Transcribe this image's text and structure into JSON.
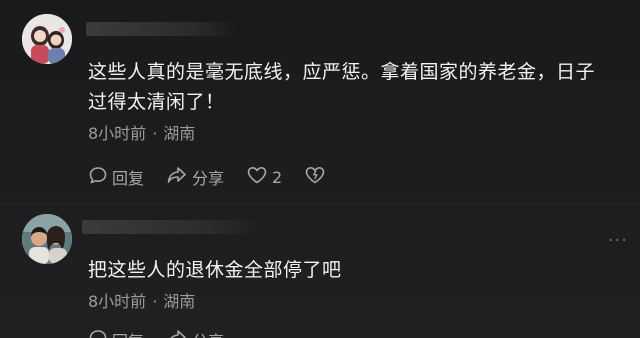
{
  "comments": [
    {
      "text_line1": "这些人真的是毫无底线，应严惩。拿着国家的养老金，日子",
      "text_line2": "过得太清闲了！",
      "time": "8小时前",
      "separator": "·",
      "location": "湖南",
      "actions": {
        "reply_label": "回复",
        "share_label": "分享",
        "like_count": "2"
      }
    },
    {
      "text_line1": "把这些人的退休金全部停了吧",
      "time": "8小时前",
      "separator": "·",
      "location": "湖南",
      "more": "···",
      "actions": {
        "reply_label": "回复",
        "share_label": "分享"
      }
    }
  ],
  "colors": {
    "background": "#1d1d1f",
    "text": "#f2f2f2",
    "meta": "#9a9a9c"
  },
  "icons": [
    "reply-icon",
    "share-icon",
    "like-heart-icon",
    "dislike-heart-icon"
  ]
}
